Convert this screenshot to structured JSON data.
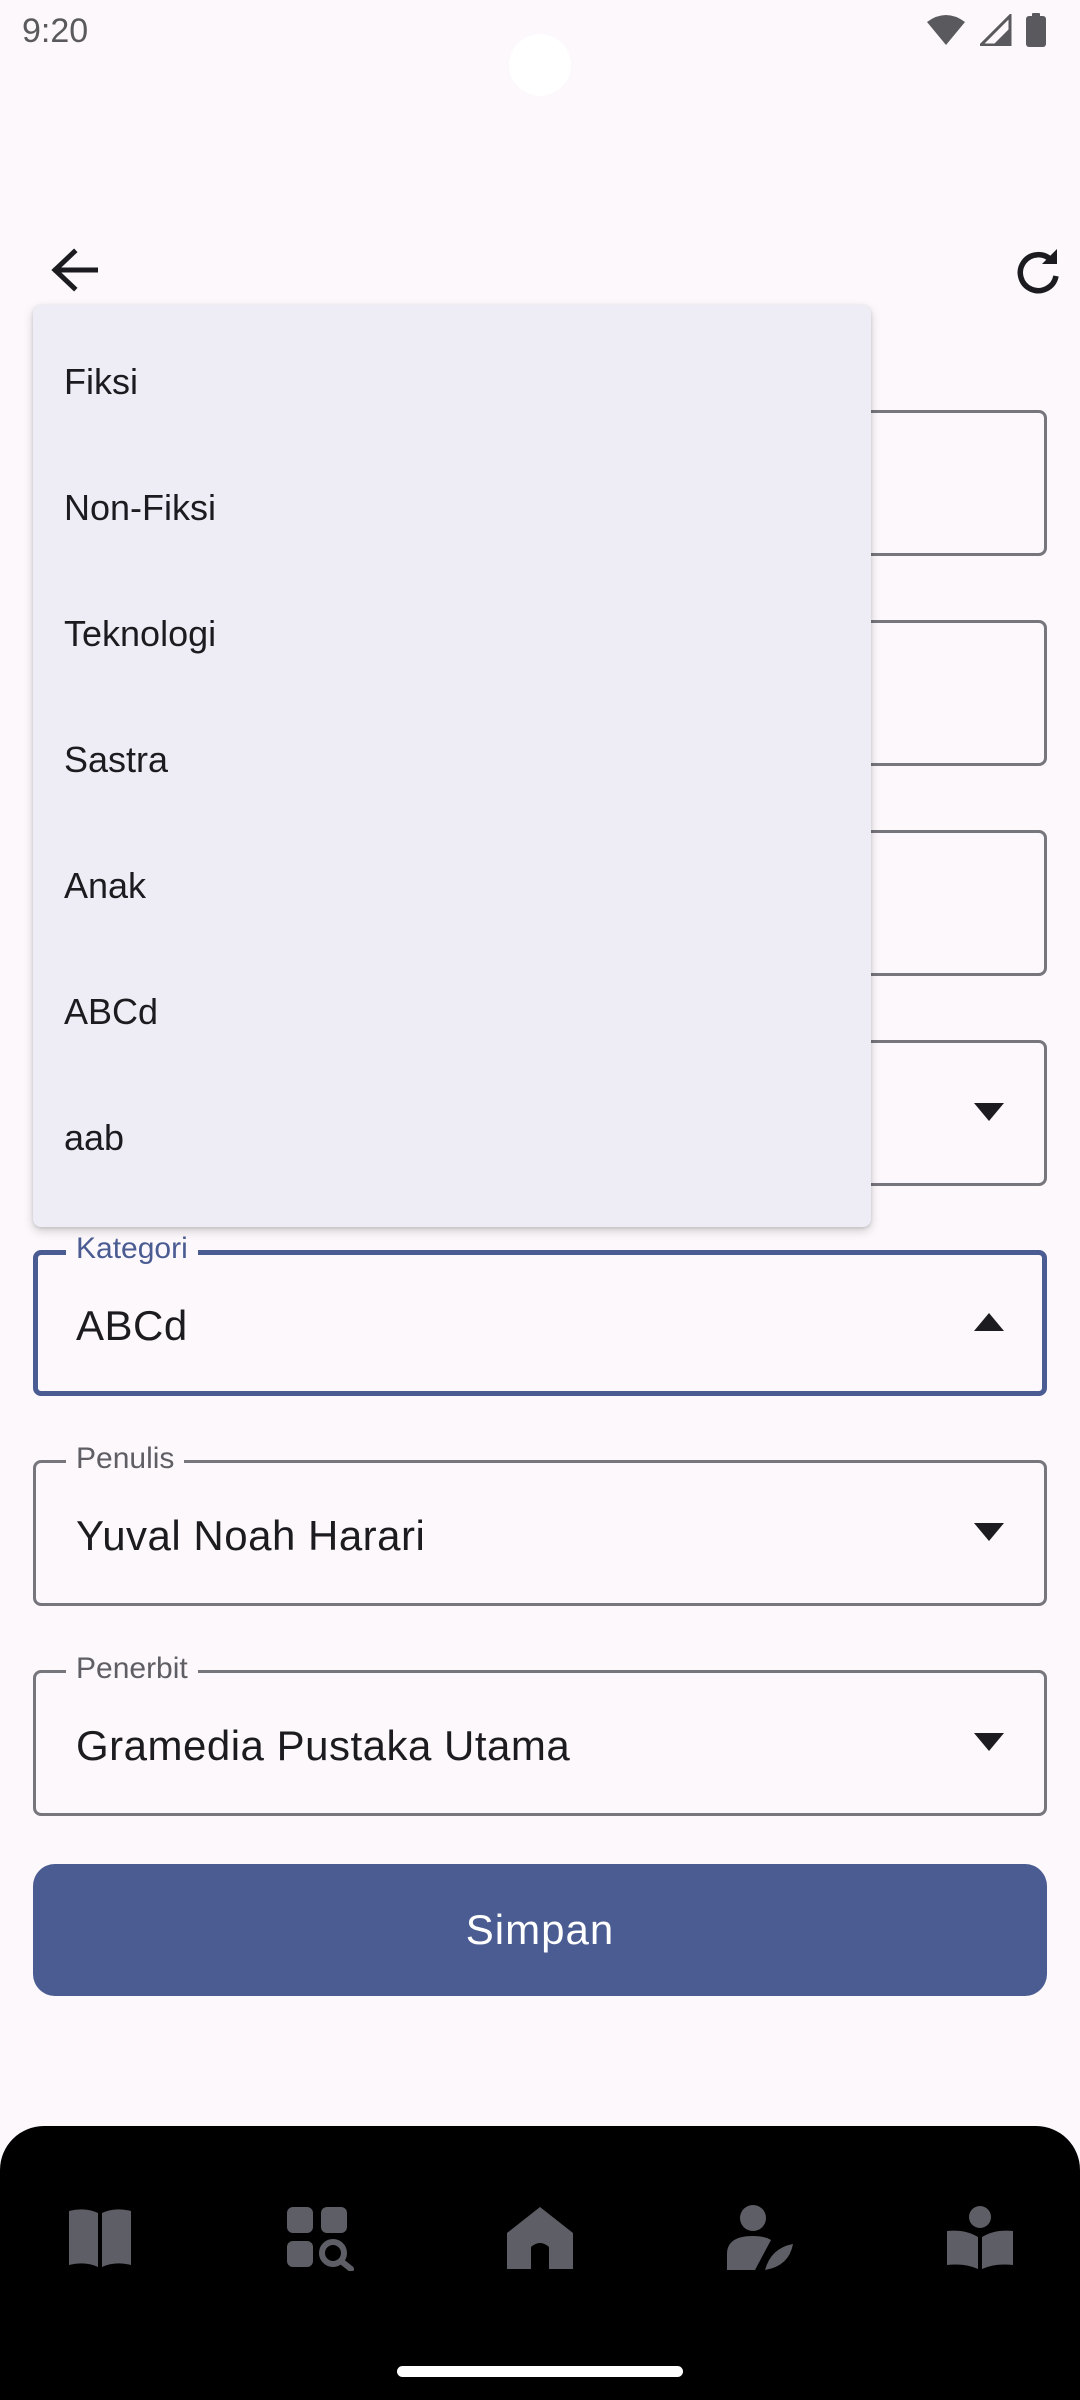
{
  "status_bar": {
    "time": "9:20",
    "icons": [
      "wifi-icon",
      "signal-icon",
      "battery-icon"
    ]
  },
  "app_bar": {
    "back_icon": "arrow-back-icon",
    "refresh_icon": "refresh-icon"
  },
  "form": {
    "kategori": {
      "label": "Kategori",
      "value": "ABCd"
    },
    "penulis": {
      "label": "Penulis",
      "value": "Yuval Noah Harari"
    },
    "penerbit": {
      "label": "Penerbit",
      "value": "Gramedia Pustaka Utama"
    },
    "save_label": "Simpan"
  },
  "dropdown": {
    "items": [
      "Fiksi",
      "Non-Fiksi",
      "Teknologi",
      "Sastra",
      "Anak",
      "ABCd",
      "aab"
    ]
  },
  "bottom_nav": {
    "items": [
      "book-icon",
      "category-search-icon",
      "home-icon",
      "author-icon",
      "reader-icon"
    ]
  },
  "colors": {
    "accent": "#4a5c92",
    "background": "#fcf8fc",
    "menu_background": "#eeedf5",
    "nav_background": "#000000"
  }
}
